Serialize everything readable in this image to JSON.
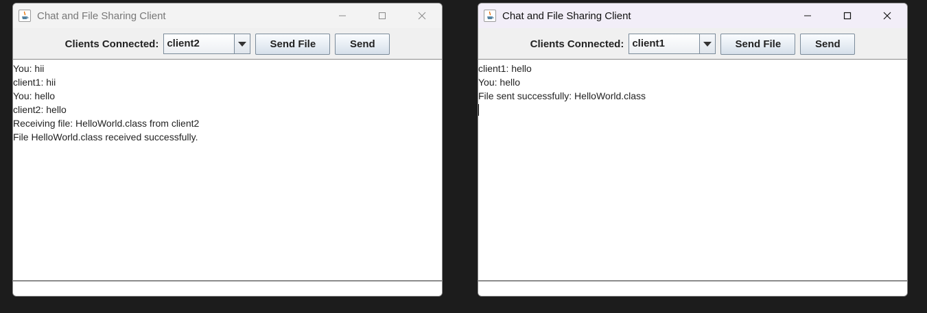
{
  "windows": [
    {
      "title": "Chat and File Sharing Client",
      "active": false,
      "clients_label": "Clients Connected:",
      "selected_client": "client2",
      "send_file_label": "Send File",
      "send_label": "Send",
      "messages": [
        "You: hii",
        "client1: hii",
        "You: hello",
        "client2: hello",
        "Receiving file: HelloWorld.class from client2",
        "File HelloWorld.class received successfully."
      ],
      "input_value": ""
    },
    {
      "title": "Chat and File Sharing Client",
      "active": true,
      "clients_label": "Clients Connected:",
      "selected_client": "client1",
      "send_file_label": "Send File",
      "send_label": "Send",
      "messages": [
        "client1: hello",
        "You: hello",
        "File sent successfully: HelloWorld.class"
      ],
      "input_value": ""
    }
  ],
  "icons": {
    "app": "java-coffee-icon",
    "minimize": "minimize-icon",
    "maximize": "maximize-icon",
    "close": "close-icon",
    "dropdown": "chevron-down-icon"
  },
  "colors": {
    "desktop_background": "#1c1c1c",
    "window_background": "#f0f0f0",
    "active_titlebar": "#f2eef8",
    "inactive_titlebar": "#f3f3f3",
    "java_icon_orange": "#e76f00",
    "java_icon_blue": "#5382a1"
  }
}
